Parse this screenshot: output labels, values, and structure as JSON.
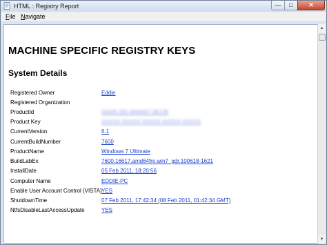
{
  "window": {
    "title": "HTML : Registry Report"
  },
  "menu": [
    {
      "label": "File",
      "underline": "F",
      "rest": "ile"
    },
    {
      "label": "Navigate",
      "underline": "N",
      "rest": "avigate"
    }
  ],
  "report": {
    "heading": "MACHINE SPECIFIC REGISTRY KEYS",
    "section": "System Details",
    "rows": [
      {
        "key": "Registered Owner",
        "value": "Eddie"
      },
      {
        "key": "Registered Organization",
        "value": ""
      },
      {
        "key": "ProductId",
        "value": "00426-292-0000007-85139"
      },
      {
        "key": "Product Key",
        "value": "XXXXX-XXXXX-XXXXX-XXXXX-XXXXX"
      },
      {
        "key": "CurrentVersion",
        "value": "6.1"
      },
      {
        "key": "CurrentBuildNumber",
        "value": "7600"
      },
      {
        "key": "ProductName",
        "value": "Windows 7 Ultimate"
      },
      {
        "key": "BuildLabEx",
        "value": "7600.16617.amd64fre.win7_gdr.100618-1621"
      },
      {
        "key": "InstallDate",
        "value": "05 Feb 2011, 18:20:56"
      },
      {
        "key": "Computer Name",
        "value": "EDDIE-PC"
      },
      {
        "key": "Enable User Account Control (VISTA)",
        "value": "YES"
      },
      {
        "key": "ShutdownTime",
        "value": "07 Feb 2011, 17:42:34 (08 Feb 2011, 01:42:34 GMT)"
      },
      {
        "key": "NtfsDisableLastAccessUpdate",
        "value": "YES"
      }
    ]
  }
}
